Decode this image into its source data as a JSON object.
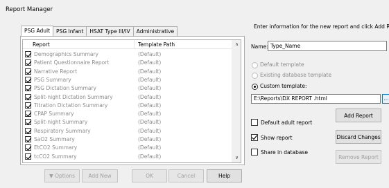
{
  "window": {
    "title": "Report Manager"
  },
  "tabs": [
    "PSG Adult",
    "PSG Infant",
    "HSAT Type III/IV",
    "Administrative"
  ],
  "list": {
    "columns": [
      "Report",
      "Template Path"
    ],
    "rows": [
      {
        "name": "Demographics Summary",
        "path": "(Default)",
        "checked": true
      },
      {
        "name": "Patient Questionnaire Report",
        "path": "(Default)",
        "checked": true
      },
      {
        "name": "Narrative Report",
        "path": "(Default)",
        "checked": true
      },
      {
        "name": "PSG Summary",
        "path": "(Default)",
        "checked": true
      },
      {
        "name": "PSG Dictation Summary",
        "path": "(Default)",
        "checked": true
      },
      {
        "name": "Split-night Dictation Summary",
        "path": "(Default)",
        "checked": true
      },
      {
        "name": "Titration Dictation Summary",
        "path": "(Default)",
        "checked": true
      },
      {
        "name": "CPAP Summary",
        "path": "(Default)",
        "checked": true
      },
      {
        "name": "Split-night Summary",
        "path": "(Default)",
        "checked": true
      },
      {
        "name": "Respiratory Summary",
        "path": "(Default)",
        "checked": true
      },
      {
        "name": "SaO2 Summary",
        "path": "(Default)",
        "checked": true
      },
      {
        "name": "EtCO2 Summary",
        "path": "(Default)",
        "checked": true
      },
      {
        "name": "tcCO2 Summary",
        "path": "(Default)",
        "checked": true
      }
    ]
  },
  "bottom_buttons": {
    "options": "▼ Options",
    "add_new": "Add New",
    "ok": "OK",
    "cancel": "Cancel",
    "help": "Help"
  },
  "right": {
    "instruction": "Enter information for the new report and click Add Report",
    "name_label": "Name:",
    "name_value": "Type_Name",
    "radio_default": "Default template",
    "radio_existing": "Existing database template",
    "radio_custom": "Custom template:",
    "template_path": "E:\\Reports\\DX REPORT .html",
    "browse_label": "...",
    "default_adult": "Default adult report",
    "show_report": "Show report",
    "share_db": "Share in database",
    "add_report": "Add Report",
    "discard_changes": "Discard Changes",
    "remove_report": "Remove Report"
  }
}
